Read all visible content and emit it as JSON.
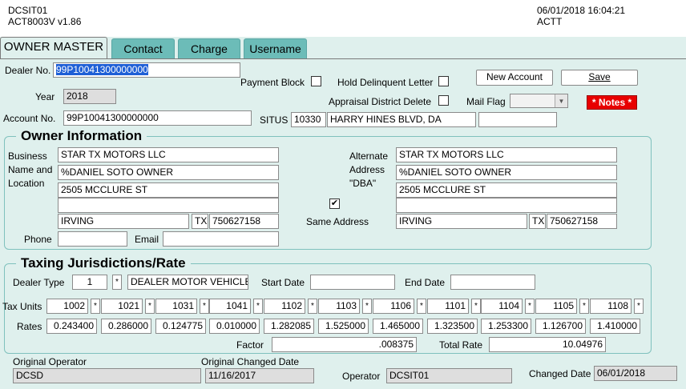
{
  "header": {
    "screen_id": "DCSIT01",
    "program_version": "ACT8003V  v1.86",
    "datetime": "06/01/2018 16:04:21",
    "org": "ACTT"
  },
  "tabs": [
    {
      "label": "OWNER MASTER"
    },
    {
      "label": "Contact"
    },
    {
      "label": "Charge"
    },
    {
      "label": "Username"
    }
  ],
  "account": {
    "dealer_no_label": "Dealer No.",
    "dealer_no": "99P10041300000000",
    "year_label": "Year",
    "year": "2018",
    "account_no_label": "Account No.",
    "account_no": "99P10041300000000",
    "payment_block_label": "Payment Block",
    "hold_delinquent_label": "Hold Delinquent Letter",
    "appraisal_delete_label": "Appraisal District Delete",
    "mail_flag_label": "Mail Flag",
    "mail_flag": "",
    "situs_label": "SITUS",
    "situs_number": "10330",
    "situs_street": "HARRY HINES BLVD, DA",
    "situs_extra": "",
    "new_account_label": "New Account",
    "save_label": "Save",
    "notes_label": "* Notes *"
  },
  "owner": {
    "title": "Owner Information",
    "business_label_1": "Business",
    "business_label_2": "Name and",
    "business_label_3": "Location",
    "business_line1": "STAR TX MOTORS LLC",
    "business_line2": "%DANIEL SOTO OWNER",
    "business_line3": "2505 MCCLURE ST",
    "business_line4": "",
    "city": "IRVING",
    "state": "TX",
    "zip": "750627158",
    "phone_label": "Phone",
    "phone": "",
    "email_label": "Email",
    "email": "",
    "alt_label_1": "Alternate",
    "alt_label_2": "Address",
    "alt_label_3": "\"DBA\"",
    "alt_line1": "STAR TX MOTORS LLC",
    "alt_line2": "%DANIEL SOTO OWNER",
    "alt_line3": "2505 MCCLURE ST",
    "alt_line4": "",
    "alt_city": "IRVING",
    "alt_state": "TX",
    "alt_zip": "750627158",
    "same_address_label": "Same Address",
    "same_address_checked": "✔"
  },
  "taxing": {
    "title": "Taxing Jurisdictions/Rate",
    "dealer_type_label": "Dealer Type",
    "dealer_type_code": "1",
    "dealer_type_desc": "DEALER MOTOR VEHICLE",
    "start_date_label": "Start Date",
    "start_date": "",
    "end_date_label": "End Date",
    "end_date": "",
    "tax_units_label": "Tax Units",
    "rates_label": "Rates",
    "tax_units": [
      "1002",
      "1021",
      "1031",
      "1041",
      "1102",
      "1103",
      "1106",
      "1101",
      "1104",
      "1105",
      "1108"
    ],
    "rates": [
      "0.243400",
      "0.286000",
      "0.124775",
      "0.010000",
      "1.282085",
      "1.525000",
      "1.465000",
      "1.323500",
      "1.253300",
      "1.126700",
      "1.410000"
    ],
    "factor_label": "Factor",
    "factor": ".008375",
    "total_rate_label": "Total Rate",
    "total_rate": "10.04976"
  },
  "footer": {
    "orig_operator_label": "Original Operator",
    "orig_operator": "DCSD",
    "orig_changed_label": "Original Changed Date",
    "orig_changed": "11/16/2017",
    "operator_label": "Operator",
    "operator": "DCSIT01",
    "changed_label": "Changed Date",
    "changed": "06/01/2018"
  },
  "symbols": {
    "star": "*",
    "dropdown": "▼"
  }
}
